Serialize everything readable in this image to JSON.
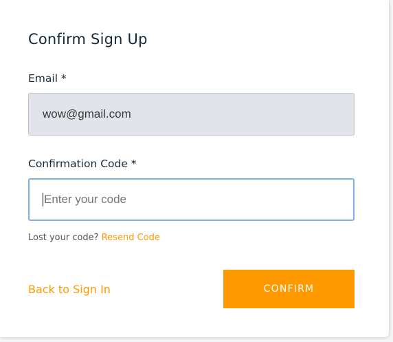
{
  "form": {
    "title": "Confirm Sign Up",
    "email": {
      "label": "Email *",
      "value": "wow@gmail.com"
    },
    "code": {
      "label": "Confirmation Code *",
      "placeholder": "Enter your code"
    },
    "hint": {
      "text": "Lost your code?",
      "link": "Resend Code"
    },
    "back_link": "Back to Sign In",
    "confirm_label": "CONFIRM"
  },
  "colors": {
    "accent": "#ff9900",
    "text": "#152939",
    "email_field_bg": "#e1e4ea",
    "focus_border": "#80aee6"
  }
}
